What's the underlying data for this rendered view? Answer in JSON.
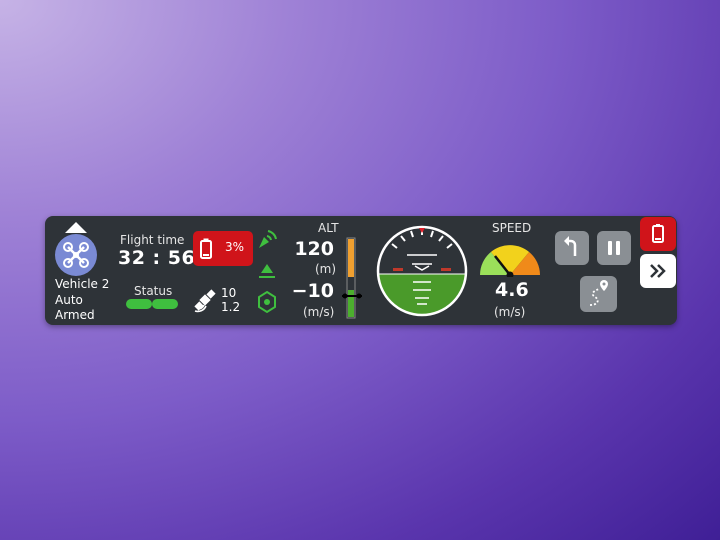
{
  "vehicle": {
    "name": "Vehicle 2",
    "mode": "Auto",
    "arm_state": "Armed",
    "avatar_icon": "quadcopter-icon",
    "avatar_color": "#7a8ad4"
  },
  "flight_time": {
    "label": "Flight time",
    "value": "32 : 56"
  },
  "status": {
    "label": "Status",
    "color": "#3fbf3f"
  },
  "battery": {
    "percent_text": "3%",
    "icon": "battery-icon",
    "color": "#d0141a"
  },
  "signal_icons": [
    "signal-icon",
    "landing-icon",
    "hex-nut-icon"
  ],
  "gps": {
    "satellites": "10",
    "hdop": "1.2",
    "icon": "satellite-icon"
  },
  "altitude": {
    "label": "ALT",
    "value": "120",
    "value_unit": "(m)",
    "vertical_speed": "−10",
    "vertical_speed_unit": "(m/s)"
  },
  "attitude_indicator": {
    "icon": "artificial-horizon-icon",
    "sky_color": "#2e3338",
    "ground_color": "#4a9a2a"
  },
  "speed": {
    "label": "SPEED",
    "value": "4.6",
    "unit": "(m/s)",
    "gauge_colors": [
      "#9be05a",
      "#f2d21c",
      "#f08a1a"
    ]
  },
  "controls": {
    "return_icon": "return-arrow-icon",
    "pause_icon": "pause-icon",
    "route_icon": "route-icon",
    "alert_icon": "battery-alert-icon",
    "expand_icon": "double-chevron-right-icon"
  }
}
